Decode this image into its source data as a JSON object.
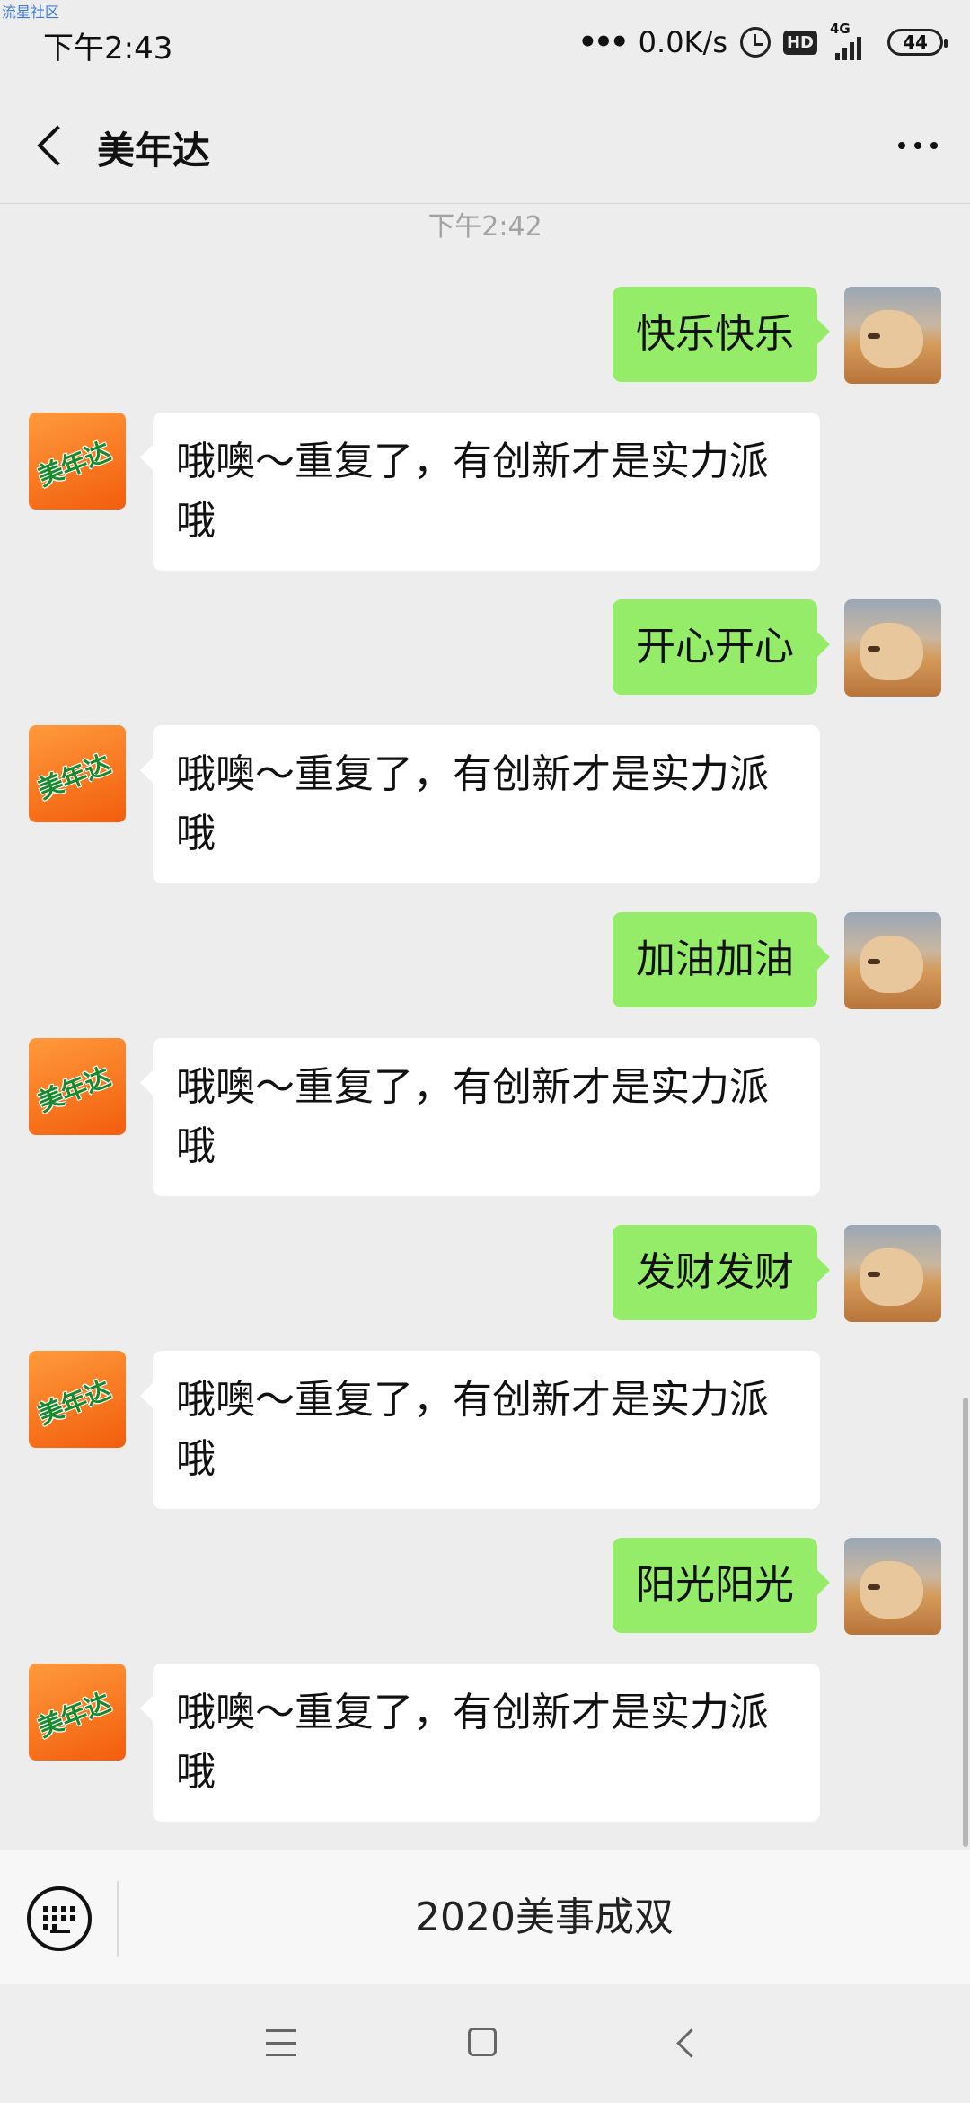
{
  "watermark": "流星社区",
  "status_bar": {
    "time": "下午2:43",
    "speed": "0.0K/s",
    "hd_label": "HD",
    "network": "4G",
    "battery": "44",
    "icons": [
      "dots-icon",
      "alarm-icon",
      "hd-icon",
      "signal-icon",
      "battery-icon"
    ]
  },
  "nav": {
    "title": "美年达",
    "back_icon": "chevron-left-icon",
    "more_icon": "more-dots-icon"
  },
  "chat": {
    "timestamp": "下午2:42",
    "bot_avatar_text": "美年达",
    "messages": [
      {
        "from": "me",
        "text": "快乐快乐"
      },
      {
        "from": "bot",
        "text": "哦噢～重复了，有创新才是实力派哦"
      },
      {
        "from": "me",
        "text": "开心开心"
      },
      {
        "from": "bot",
        "text": "哦噢～重复了，有创新才是实力派哦"
      },
      {
        "from": "me",
        "text": "加油加油"
      },
      {
        "from": "bot",
        "text": "哦噢～重复了，有创新才是实力派哦"
      },
      {
        "from": "me",
        "text": "发财发财"
      },
      {
        "from": "bot",
        "text": "哦噢～重复了，有创新才是实力派哦"
      },
      {
        "from": "me",
        "text": "阳光阳光"
      },
      {
        "from": "bot",
        "text": "哦噢～重复了，有创新才是实力派哦"
      }
    ]
  },
  "input_bar": {
    "keyboard_icon": "keyboard-icon",
    "menu_label": "2020美事成双"
  },
  "system_nav": {
    "icons": [
      "menu-icon",
      "home-icon",
      "back-icon"
    ]
  },
  "colors": {
    "background": "#ededed",
    "outgoing_bubble": "#95ec69",
    "incoming_bubble": "#ffffff",
    "bot_avatar": "#f47a1f"
  }
}
